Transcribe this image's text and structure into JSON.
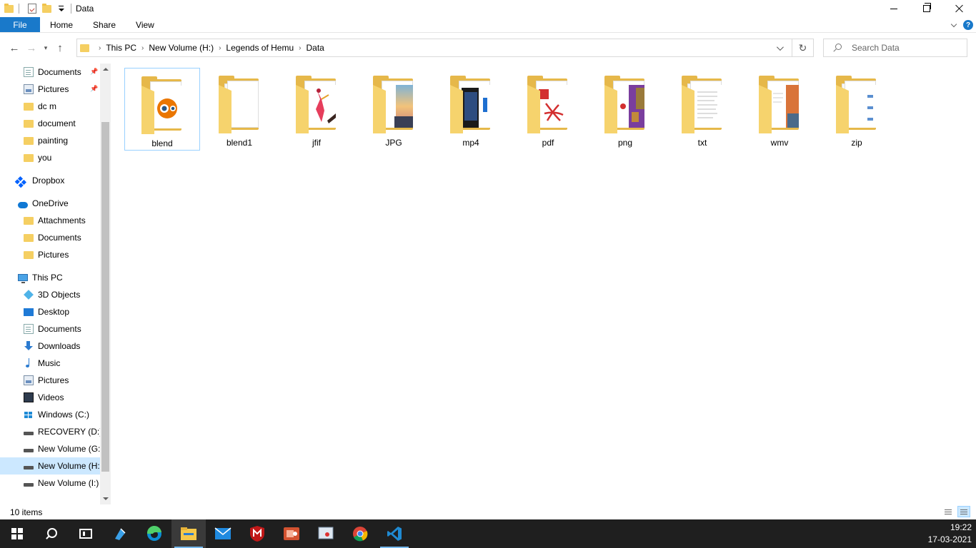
{
  "window": {
    "title": "Data"
  },
  "ribbon": {
    "tabs": [
      "File",
      "Home",
      "Share",
      "View"
    ],
    "help_label": "?"
  },
  "address": {
    "crumbs": [
      "This PC",
      "New Volume (H:)",
      "Legends of Hemu",
      "Data"
    ],
    "refresh_glyph": "↻"
  },
  "search": {
    "placeholder": "Search Data"
  },
  "sidebar": {
    "items": [
      {
        "label": "Documents",
        "icon": "documents-icon",
        "pinned": true
      },
      {
        "label": "Pictures",
        "icon": "pictures-icon",
        "pinned": true
      },
      {
        "label": "dc m",
        "icon": "folder-icon"
      },
      {
        "label": "document",
        "icon": "folder-icon"
      },
      {
        "label": "painting",
        "icon": "folder-icon"
      },
      {
        "label": "you",
        "icon": "folder-icon"
      },
      {
        "label": "Dropbox",
        "icon": "dropbox-icon"
      },
      {
        "label": "OneDrive",
        "icon": "onedrive-icon"
      },
      {
        "label": "Attachments",
        "icon": "folder-icon"
      },
      {
        "label": "Documents",
        "icon": "folder-icon"
      },
      {
        "label": "Pictures",
        "icon": "folder-icon"
      },
      {
        "label": "This PC",
        "icon": "this-pc-icon"
      },
      {
        "label": "3D Objects",
        "icon": "3d-objects-icon"
      },
      {
        "label": "Desktop",
        "icon": "desktop-icon"
      },
      {
        "label": "Documents",
        "icon": "documents-icon"
      },
      {
        "label": "Downloads",
        "icon": "downloads-icon"
      },
      {
        "label": "Music",
        "icon": "music-icon"
      },
      {
        "label": "Pictures",
        "icon": "pictures-icon"
      },
      {
        "label": "Videos",
        "icon": "videos-icon"
      },
      {
        "label": "Windows (C:)",
        "icon": "windows-drive-icon"
      },
      {
        "label": "RECOVERY (D:)",
        "icon": "drive-icon"
      },
      {
        "label": "New Volume (G:",
        "icon": "drive-icon"
      },
      {
        "label": "New Volume (H:",
        "icon": "drive-icon",
        "selected": true
      },
      {
        "label": "New Volume (I:)",
        "icon": "drive-icon"
      }
    ]
  },
  "folders": [
    {
      "name": "blend",
      "selected": true,
      "preview": "blender-logo"
    },
    {
      "name": "blend1",
      "preview": "blank-pages"
    },
    {
      "name": "jfif",
      "preview": "dancer-image"
    },
    {
      "name": "JPG",
      "preview": "sunset-image"
    },
    {
      "name": "mp4",
      "preview": "video-frame"
    },
    {
      "name": "pdf",
      "preview": "pdf-logo"
    },
    {
      "name": "png",
      "preview": "purple-image"
    },
    {
      "name": "txt",
      "preview": "text-pages"
    },
    {
      "name": "wmv",
      "preview": "orange-image"
    },
    {
      "name": "zip",
      "preview": "blank-pages"
    }
  ],
  "status": {
    "item_count": "10 items"
  },
  "taskbar": {
    "time": "19:22",
    "date": "17-03-2021",
    "apps": [
      "cortana-search",
      "task-view",
      "visual-studio",
      "edge",
      "file-explorer",
      "mail",
      "mcafee",
      "powerpoint",
      "snipping-tool",
      "chrome",
      "vscode"
    ]
  },
  "colors": {
    "accent": "#1979ca",
    "folder": "#f5cf62",
    "selection": "#cce8ff",
    "taskbar": "#1f1f1f"
  }
}
